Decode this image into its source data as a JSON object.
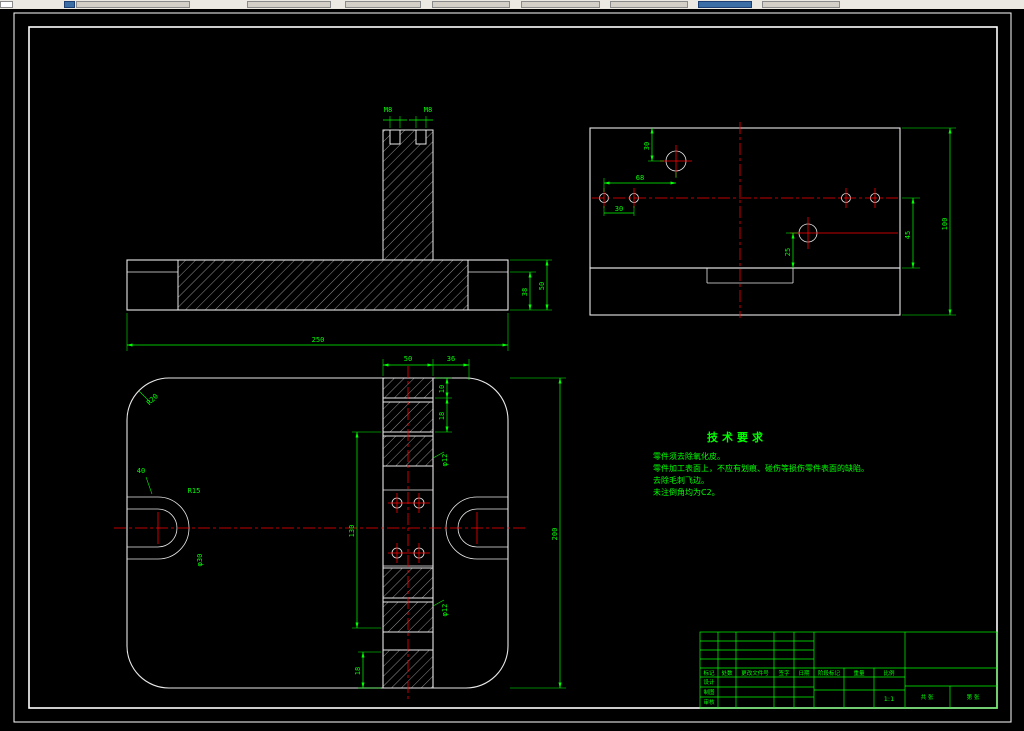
{
  "colors": {
    "background": "#000000",
    "geometry": "#ffffff",
    "dimension": "#00ff00",
    "centerline": "#ff0000"
  },
  "front_view": {
    "dims": {
      "width": "250",
      "height": "50",
      "step": "38",
      "tap_left": "M8",
      "tap_right": "M8"
    }
  },
  "side_view": {
    "dims": {
      "hole_offset": "30",
      "hole_span": "68",
      "pair_span": "30",
      "right_inner": "45",
      "overall": "100",
      "boss": "25"
    }
  },
  "plan_view": {
    "dims": {
      "strip_width": "50",
      "strip_right": "36",
      "top_a": "10",
      "top_b": "18",
      "dia_top": "φ12",
      "dia_bottom": "φ12",
      "left_len": "130",
      "right_len": "200",
      "bottom": "18",
      "corner_r": "R20",
      "slot_w": "40",
      "slot_r": "R15",
      "slot_d": "φ30"
    }
  },
  "tech": {
    "title": "技术要求",
    "lines": [
      "零件须去除氧化皮。",
      "零件加工表面上，不应有划痕、碰伤等损伤零件表面的缺陷。",
      "去除毛刺飞边。",
      "未注倒角均为C2。"
    ]
  },
  "title_block": {
    "rev_header": [
      "标记",
      "处数",
      "更改文件号",
      "签字",
      "日期"
    ],
    "rows": [
      "设计",
      "制图",
      "审核"
    ],
    "mid_header": [
      "阶段标记",
      "重量",
      "比例"
    ],
    "scale_value": "1:1",
    "sheet_total": "共 张",
    "sheet_no": "第 张"
  }
}
